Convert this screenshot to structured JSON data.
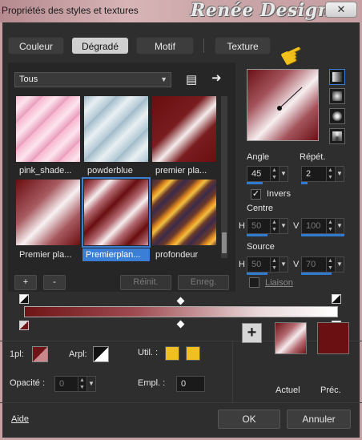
{
  "window": {
    "title": "Propriétés des styles et textures",
    "close_glyph": "✕",
    "watermark": "Renée Design"
  },
  "tabs": [
    {
      "label": "Couleur",
      "active": false
    },
    {
      "label": "Dégradé",
      "active": true
    },
    {
      "label": "Motif",
      "active": false
    },
    {
      "label": "Texture",
      "active": false
    }
  ],
  "library": {
    "category": "Tous",
    "thumbnails": [
      {
        "label": "pink_shade...",
        "selected": false
      },
      {
        "label": "powderblue",
        "selected": false
      },
      {
        "label": "premier pla...",
        "selected": false
      },
      {
        "label": "Premier pla...",
        "selected": false
      },
      {
        "label": "Premierplan...",
        "selected": true
      },
      {
        "label": "profondeur",
        "selected": false
      }
    ],
    "add_label": "+",
    "remove_label": "-",
    "reset_label": "Réinit.",
    "save_label": "Enreg."
  },
  "settings": {
    "angle_label": "Angle",
    "angle_value": "45",
    "repeat_label": "Répét.",
    "repeat_value": "2",
    "invert_label": "Invers",
    "invert_checked": true,
    "center_label": "Centre",
    "center_h_label": "H",
    "center_h_value": "50",
    "center_v_label": "V",
    "center_v_value": "100",
    "source_label": "Source",
    "source_h_label": "H",
    "source_h_value": "50",
    "source_v_label": "V",
    "source_v_value": "70",
    "link_label": "Liaison",
    "link_checked": false
  },
  "gradient_editor": {
    "stop_colors": [
      "#6d1416",
      "#ffffff"
    ]
  },
  "stops": {
    "fg_label": "1pl:",
    "bg_label": "Arpl:",
    "user_label": "Util. :",
    "opacity_label": "Opacité :",
    "opacity_value": "0",
    "location_label": "Empl. :",
    "location_value": "0"
  },
  "current": {
    "current_label": "Actuel",
    "previous_label": "Préc.",
    "add_glyph": "+",
    "previous_color": "#6a0f12"
  },
  "footer": {
    "help_label": "Aide",
    "ok_label": "OK",
    "cancel_label": "Annuler"
  },
  "colors": {
    "accent": "#3a7fd5",
    "user_color": "#f0c020",
    "burgundy": "#6d1416"
  }
}
